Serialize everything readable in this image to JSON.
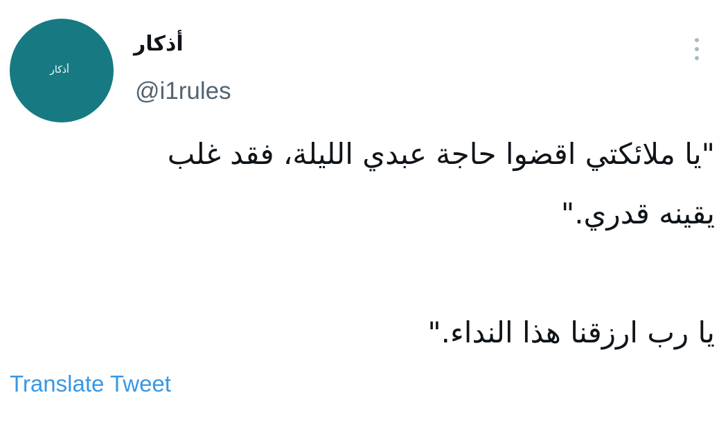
{
  "tweet": {
    "avatar_text": "أذكار",
    "display_name": "أذكار",
    "handle": "@i1rules",
    "more_icon": "more-vertical-icon",
    "body_lines": [
      "\"يا ملائكتي اقضوا حاجة عبدي الليلة، فقد غلب",
      "يقينه قدري.\"",
      "يا رب ارزقنا هذا النداء.\""
    ],
    "translate_label": "Translate Tweet"
  },
  "colors": {
    "avatar": "#177a82",
    "handle": "#536471",
    "link": "#3897e3",
    "more_dots": "#aab8c2",
    "text": "#0f1419"
  }
}
